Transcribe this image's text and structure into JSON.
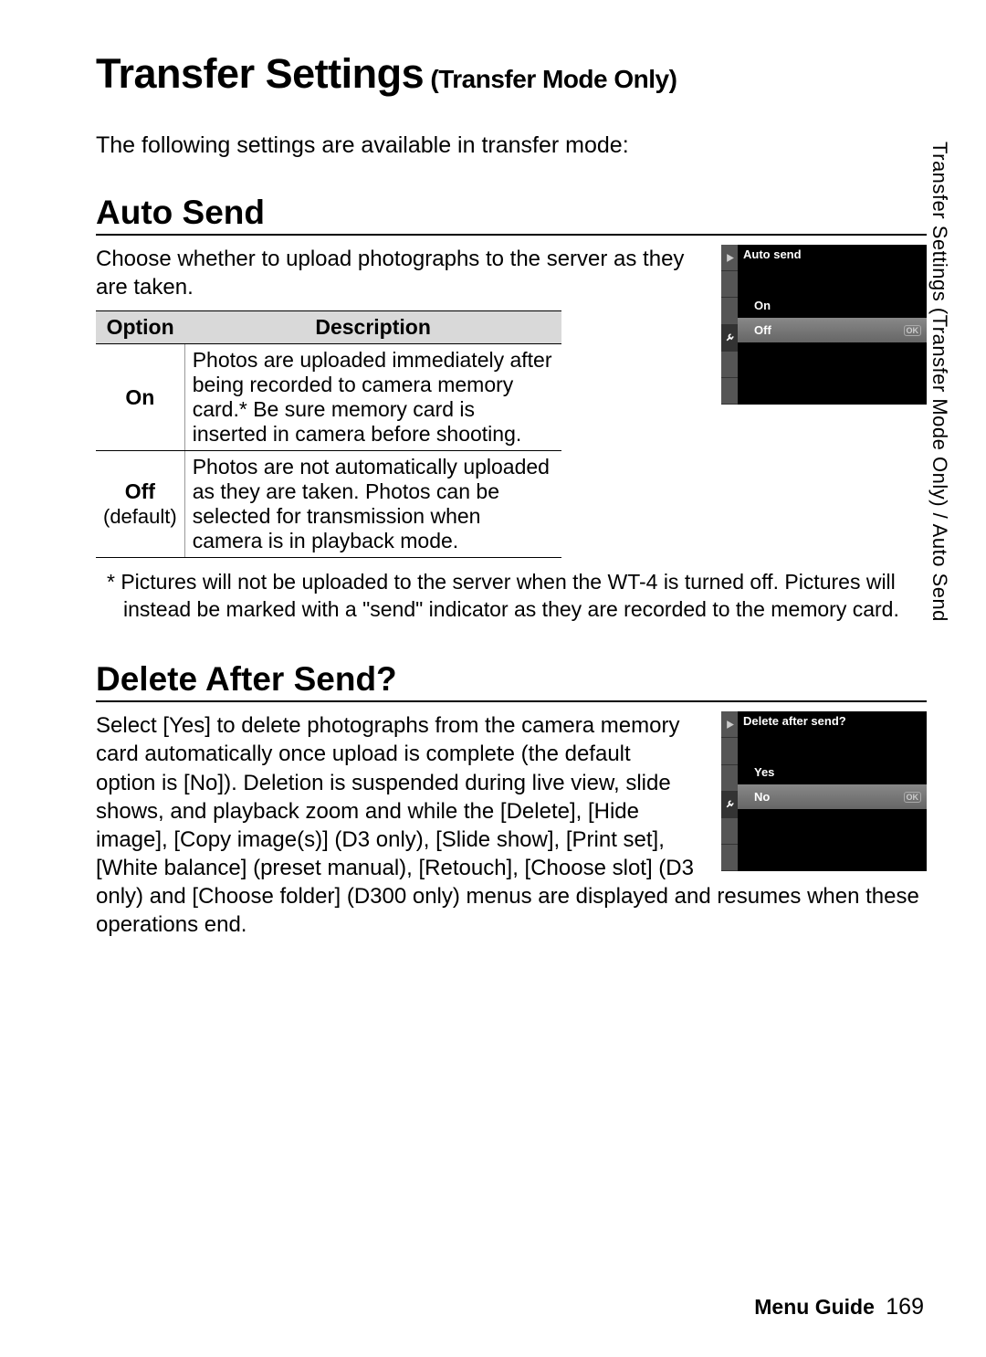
{
  "title": {
    "main": "Transfer Settings",
    "sub": " (Transfer Mode Only)"
  },
  "intro": "The following settings are available in transfer mode:",
  "sidebar_label": "Transfer Settings (Transfer Mode Only) / Auto Send",
  "auto_send": {
    "heading": "Auto Send",
    "description": "Choose whether to upload photographs to the server as they are taken.",
    "table": {
      "headers": {
        "option": "Option",
        "description": "Description"
      },
      "rows": [
        {
          "option": "On",
          "default": "",
          "description": "Photos are uploaded immediately after being recorded to camera memory card.* Be sure memory card is inserted in camera before shooting."
        },
        {
          "option": "Off",
          "default": "(default)",
          "description": "Photos are not automatically uploaded as they are taken.  Photos can be selected for transmission when camera is in playback mode."
        }
      ]
    },
    "footnote": "* Pictures will not be uploaded to the server when the WT-4 is turned off. Pictures will instead be marked with a \"send\" indicator as they are recorded to the memory card.",
    "screenshot": {
      "title": "Auto send",
      "items": [
        "On",
        "Off"
      ],
      "selected_index": 1,
      "ok_label": "OK"
    }
  },
  "delete_after": {
    "heading": "Delete After Send?",
    "description": "Select [Yes] to delete photographs from the camera memory card automatically once upload is complete (the default option is [No]).  Deletion is suspended during live view, slide shows, and playback zoom and while the [Delete], [Hide image], [Copy image(s)] (D3 only), [Slide show], [Print set], [White balance] (preset manual), [Retouch], [Choose slot] (D3 only) and [Choose folder] (D300 only) menus are displayed and resumes when these operations end.",
    "screenshot": {
      "title": "Delete after send?",
      "items": [
        "Yes",
        "No"
      ],
      "selected_index": 1,
      "ok_label": "OK"
    }
  },
  "footer": {
    "section": "Menu Guide",
    "page": "169"
  }
}
